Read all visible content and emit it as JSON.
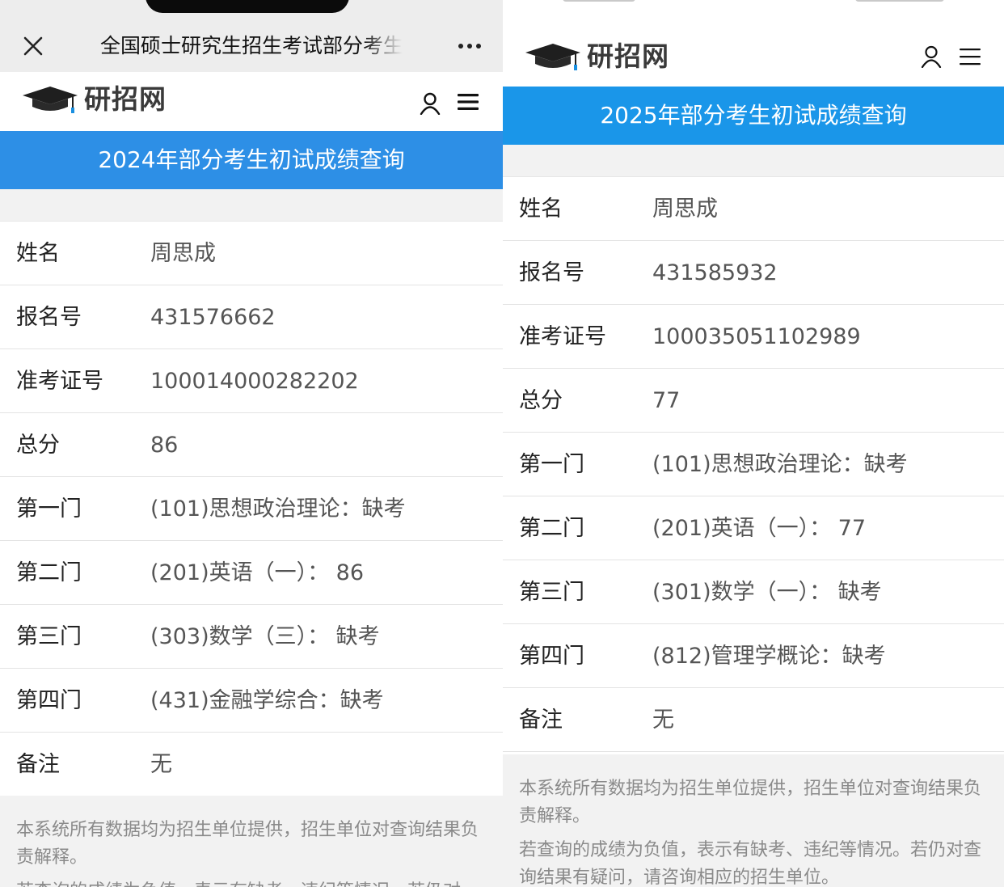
{
  "left": {
    "topbar": {
      "title": "全国硕士研究生招生考试部分考生",
      "close_icon": "close-icon",
      "more_icon": "more-dots-icon"
    },
    "header": {
      "logo_text": "研招网",
      "user_icon": "user-icon",
      "menu_icon": "menu-icon"
    },
    "banner": "2024年部分考生初试成绩查询",
    "rows": [
      {
        "label": "姓名",
        "value": "周思成"
      },
      {
        "label": "报名号",
        "value": "431576662"
      },
      {
        "label": "准考证号",
        "value": "100014000282202"
      },
      {
        "label": "总分",
        "value": "86"
      },
      {
        "label": "第一门",
        "value": "(101)思想政治理论：缺考"
      },
      {
        "label": "第二门",
        "value": "(201)英语（一）： 86"
      },
      {
        "label": "第三门",
        "value": "(303)数学（三）： 缺考"
      },
      {
        "label": "第四门",
        "value": "(431)金融学综合：缺考"
      },
      {
        "label": "备注",
        "value": "无"
      }
    ],
    "notes": [
      "本系统所有数据均为招生单位提供，招生单位对查询结果负责解释。",
      "若查询的成绩为负值，表示有缺考、违纪等情况。若仍对"
    ]
  },
  "right": {
    "header": {
      "logo_text": "研招网",
      "user_icon": "user-icon",
      "menu_icon": "menu-icon"
    },
    "banner": "2025年部分考生初试成绩查询",
    "rows": [
      {
        "label": "姓名",
        "value": "周思成"
      },
      {
        "label": "报名号",
        "value": "431585932"
      },
      {
        "label": "准考证号",
        "value": "100035051102989"
      },
      {
        "label": "总分",
        "value": "77"
      },
      {
        "label": "第一门",
        "value": "(101)思想政治理论：缺考"
      },
      {
        "label": "第二门",
        "value": "(201)英语（一）： 77"
      },
      {
        "label": "第三门",
        "value": "(301)数学（一）： 缺考"
      },
      {
        "label": "第四门",
        "value": "(812)管理学概论：缺考"
      },
      {
        "label": "备注",
        "value": "无"
      }
    ],
    "notes": [
      "本系统所有数据均为招生单位提供，招生单位对查询结果负责解释。",
      "若查询的成绩为负值，表示有缺考、违纪等情况。若仍对查询结果有疑问，请咨询相应的招生单位。"
    ]
  },
  "colors": {
    "banner_left": "#2d8fe6",
    "banner_right": "#1a96e9",
    "wechat_bar": "#ededed",
    "notes_bg": "#f2f2f2"
  }
}
